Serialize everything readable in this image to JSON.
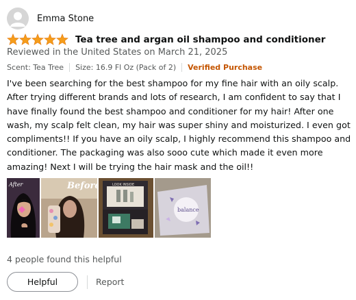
{
  "reviewer": {
    "name": "Emma Stone",
    "avatar_icon": "user-avatar-icon"
  },
  "rating": {
    "stars": 5,
    "max_stars": 5,
    "star_color": "#f59d1b"
  },
  "review": {
    "title": "Tea tree and argan oil shampoo and conditioner",
    "date": "Reviewed in the United States on March 21, 2025",
    "scent": "Scent: Tea Tree",
    "size": "Size: 16.9 Fl Oz (Pack of 2)",
    "verified": "Verified Purchase",
    "body_lines": [
      "I've been searching for the best shampoo for my fine hair with an oily scalp.",
      "After trying different brands and lots of research, I am confident to say that I",
      "have finally found the best shampoo and conditioner for my hair! After one",
      "wash, my scalp felt clean, my hair was super shiny and moisturized. I even got",
      "compliments!! If you have an oily scalp, I highly recommend this shampoo and",
      "conditioner. The packaging was also sooo cute which made it even more",
      "amazing! Next I will be trying the hair mask and the oil!!"
    ]
  },
  "images": {
    "items": [
      {
        "name": "review-image-after",
        "overlay_text": "After"
      },
      {
        "name": "review-image-before",
        "overlay_text": "Before"
      },
      {
        "name": "review-image-package-box",
        "overlay_text": "LOOK INSIDE"
      },
      {
        "name": "review-image-balance-pouch",
        "overlay_text": "balance"
      }
    ]
  },
  "footer": {
    "helpful_count": "4 people found this helpful",
    "helpful_button": "Helpful",
    "report_link": "Report"
  },
  "colors": {
    "verified": "#c45500",
    "muted_text": "#565959",
    "primary_text": "#0f1111"
  }
}
